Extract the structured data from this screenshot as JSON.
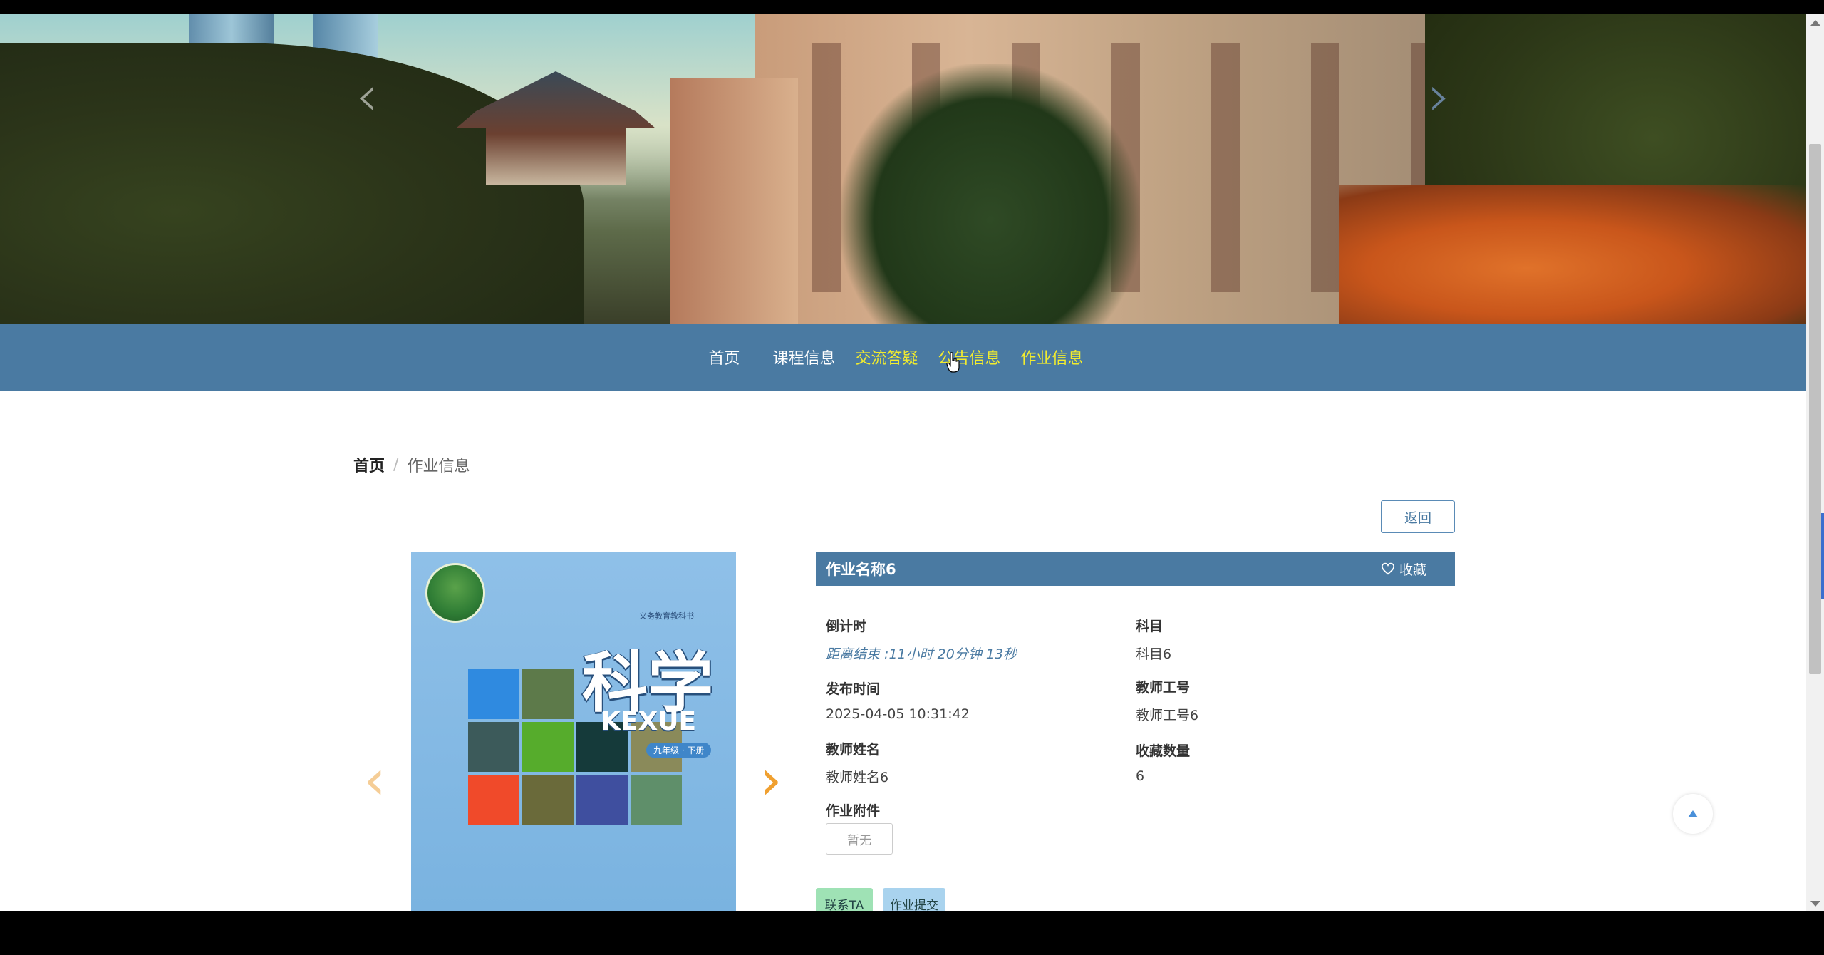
{
  "hero": {
    "prev_label": "‹",
    "next_label": "›"
  },
  "nav": {
    "items": [
      {
        "label": "首页",
        "active": false
      },
      {
        "label": "课程信息",
        "active": false
      },
      {
        "label": "交流答疑",
        "active": true
      },
      {
        "label": "公告信息",
        "active": true
      },
      {
        "label": "作业信息",
        "active": true
      }
    ]
  },
  "breadcrumb": {
    "home": "首页",
    "separator": "/",
    "current": "作业信息"
  },
  "back_label": "返回",
  "gallery": {
    "prev_label": "‹",
    "next_label": "›",
    "book": {
      "publisher_line": "义务教育教科书",
      "title_cn": "科学",
      "title_en": "KEXUE",
      "grade": "九年级 · 下册"
    }
  },
  "panel": {
    "name": "作业名称6",
    "favorite_label": "收藏",
    "fields": {
      "countdown": {
        "label": "倒计时",
        "value": "距离结束 :11小时 20分钟 13秒"
      },
      "subject": {
        "label": "科目",
        "value": "科目6"
      },
      "publish_time": {
        "label": "发布时间",
        "value": "2025-04-05 10:31:42"
      },
      "teacher_id": {
        "label": "教师工号",
        "value": "教师工号6"
      },
      "teacher_name": {
        "label": "教师姓名",
        "value": "教师姓名6"
      },
      "favorites_count": {
        "label": "收藏数量",
        "value": "6"
      },
      "attachment": {
        "label": "作业附件",
        "value": "暂无"
      }
    },
    "contact_label": "联系TA",
    "submit_label": "作业提交"
  },
  "colors": {
    "nav_bg": "#4a7aa2",
    "nav_active": "#f2ec2e",
    "contact_btn": "#9fe2b5",
    "submit_btn": "#a9d3ee",
    "arrow": "#f0a030"
  }
}
